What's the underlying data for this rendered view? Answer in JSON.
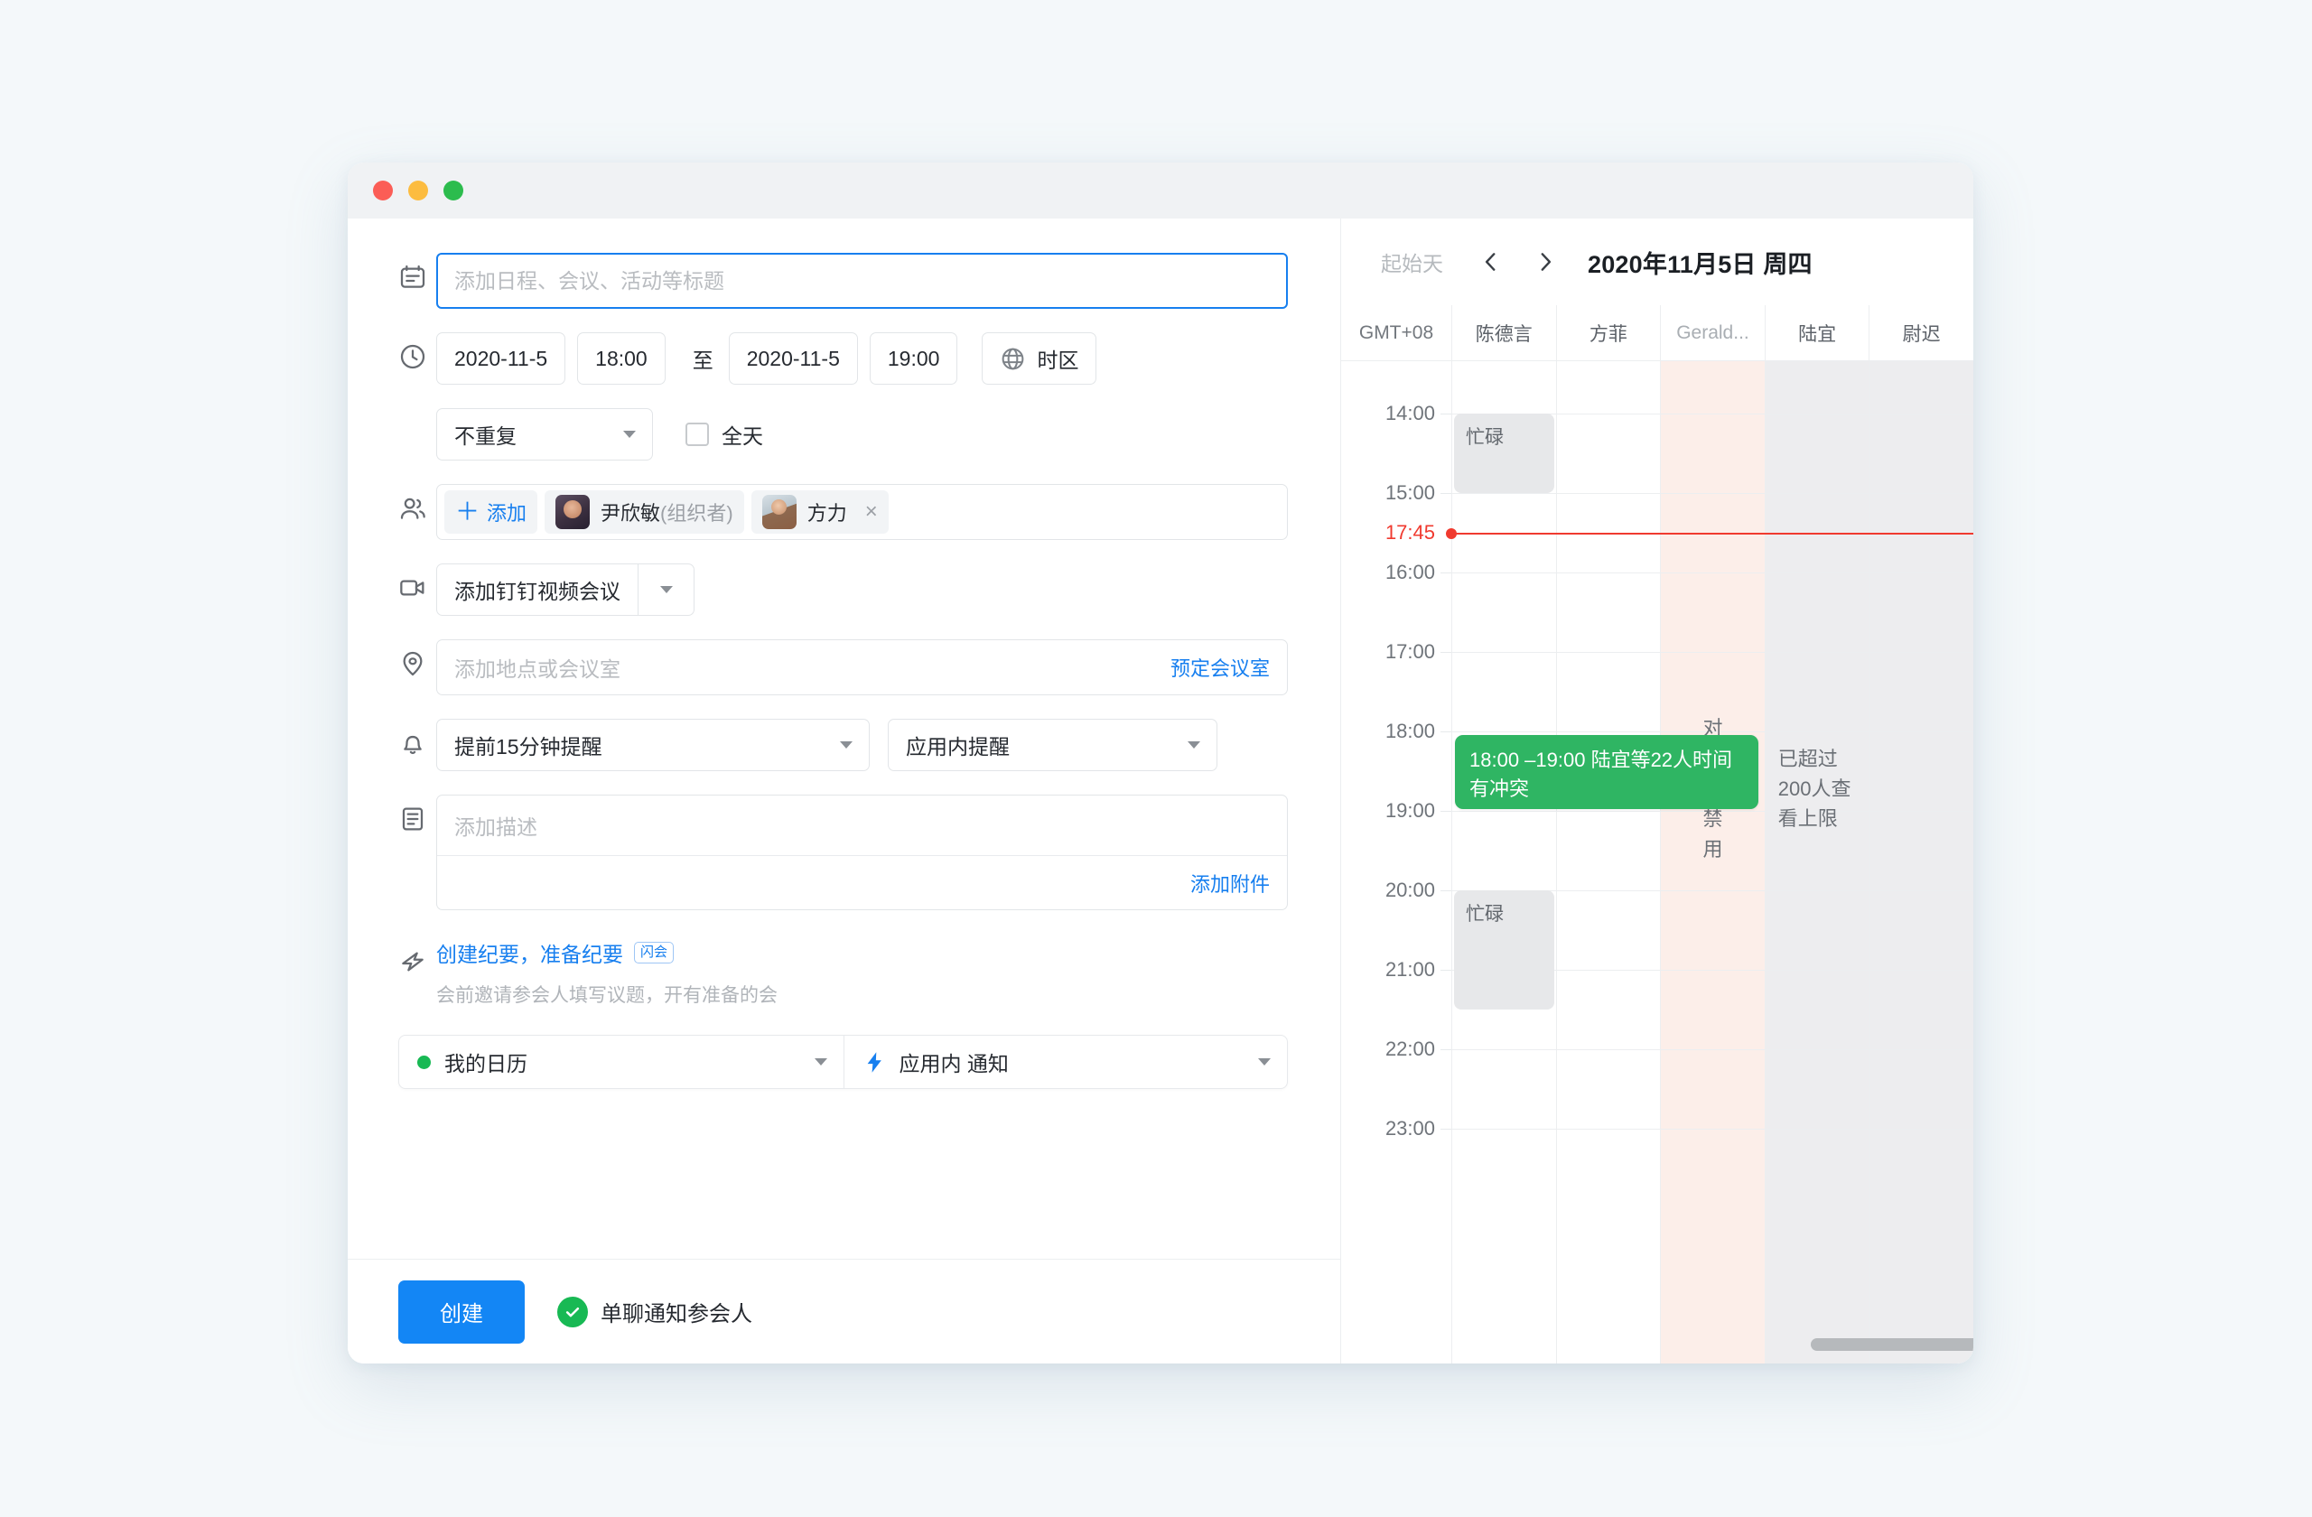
{
  "window": {
    "traffic_lights": [
      "close",
      "minimize",
      "maximize"
    ]
  },
  "form": {
    "title_placeholder": "添加日程、会议、活动等标题",
    "title_value": "",
    "datetime": {
      "start_date": "2020-11-5",
      "start_time": "18:00",
      "separator": "至",
      "end_date": "2020-11-5",
      "end_time": "19:00",
      "timezone_label": "时区"
    },
    "repeat": {
      "value": "不重复"
    },
    "all_day": {
      "label": "全天",
      "checked": false
    },
    "attendees": {
      "add_label": "添加",
      "list": [
        {
          "name": "尹欣敏",
          "role": "(组织者)",
          "removable": false
        },
        {
          "name": "方力",
          "role": "",
          "removable": true
        }
      ]
    },
    "video": {
      "value": "添加钉钉视频会议"
    },
    "location": {
      "placeholder": "添加地点或会议室",
      "value": "",
      "book_room_link": "预定会议室"
    },
    "reminder": {
      "time_value": "提前15分钟提醒",
      "channel_value": "应用内提醒"
    },
    "description": {
      "placeholder": "添加描述",
      "value": "",
      "attach_link": "添加附件"
    },
    "flash_meeting": {
      "link": "创建纪要，准备纪要",
      "badge": "闪会",
      "subtitle": "会前邀请参会人填写议题，开有准备的会"
    },
    "calendar_select": {
      "calendar_value": "我的日历",
      "calendar_dot_color": "#18b954",
      "notify_value": "应用内 通知",
      "bolt_color": "#177fef"
    },
    "footer": {
      "create_label": "创建",
      "notify_label": "单聊通知参会人",
      "notify_checked": true,
      "check_color": "#18b954",
      "create_color": "#1386f5"
    }
  },
  "calendar": {
    "start_day_label": "起始天",
    "prev_label": "‹",
    "next_label": "›",
    "date_title": "2020年11月5日 周四",
    "timezone": "GMT+08",
    "columns": [
      {
        "name": "陈德言",
        "shade": "white",
        "dim": false
      },
      {
        "name": "方菲",
        "shade": "white",
        "dim": false
      },
      {
        "name": "Gerald...",
        "shade": "pink",
        "dim": true
      },
      {
        "name": "陆宜",
        "shade": "gray",
        "dim": false
      },
      {
        "name": "尉迟",
        "shade": "gray",
        "dim": false
      }
    ],
    "time_labels": [
      "14:00",
      "15:00",
      "16:00",
      "17:00",
      "18:00",
      "19:00",
      "20:00",
      "21:00",
      "22:00",
      "23:00"
    ],
    "now_marker": {
      "label": "17:45",
      "color": "#f03a2f"
    },
    "busy_blocks": [
      {
        "column": 0,
        "label": "忙碌",
        "start": "14:00",
        "end": "15:00"
      },
      {
        "column": 0,
        "label": "忙碌",
        "start": "20:00",
        "end": "21:30"
      }
    ],
    "event": {
      "text": "18:00 –19:00 陆宜等22人时间有冲突",
      "color": "#2fb563",
      "start": "18:00",
      "end": "19:00"
    },
    "disabled_notice": "对方已禁用",
    "limit_notice": "已超过200人查看上限"
  }
}
